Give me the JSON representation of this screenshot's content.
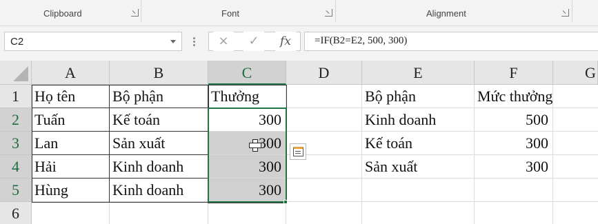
{
  "ribbon": {
    "groups": [
      {
        "label": "Clipboard"
      },
      {
        "label": "Font"
      },
      {
        "label": "Alignment"
      }
    ]
  },
  "formula_bar": {
    "name_box": "C2",
    "cancel_icon": "×",
    "enter_icon": "✓",
    "fx_label": "fx",
    "formula": "=IF(B2=E2, 500, 300)"
  },
  "columns": [
    "A",
    "B",
    "C",
    "D",
    "E",
    "F",
    "G"
  ],
  "rows": [
    "1",
    "2",
    "3",
    "4",
    "5",
    "6"
  ],
  "cells": {
    "A1": "Họ tên",
    "B1": "Bộ phận",
    "C1": "Thưởng",
    "A2": "Tuấn",
    "B2": "Kế toán",
    "C2": "300",
    "A3": "Lan",
    "B3": "Sản xuất",
    "C3": "300",
    "A4": "Hải",
    "B4": "Kinh doanh",
    "C4": "300",
    "A5": "Hùng",
    "B5": "Kinh doanh",
    "C5": "300",
    "E1": "Bộ phận",
    "F1": "Mức thưởng",
    "E2": "Kinh doanh",
    "F2": "500",
    "E3": "Kế toán",
    "F3": "300",
    "E4": "Sản xuất",
    "F4": "300"
  },
  "active_cell": "C2",
  "selection": "C2:C5",
  "colors": {
    "accent": "#217346"
  },
  "icons": [
    "dialog-launcher-icon",
    "dropdown-icon",
    "cancel-icon",
    "enter-icon",
    "fx-icon",
    "quick-analysis-icon",
    "cell-cursor-icon"
  ]
}
